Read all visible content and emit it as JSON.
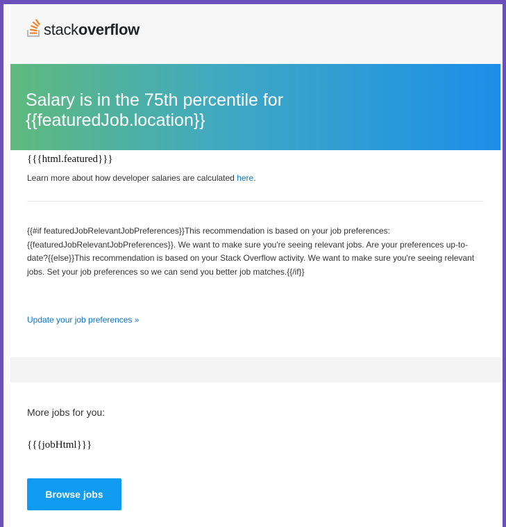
{
  "header": {
    "logo_text_light": "stack",
    "logo_text_bold": "overflow",
    "logo_icon": "stackoverflow-icon",
    "brand_color": "#f48024"
  },
  "hero": {
    "title_line1": "Salary is in the 75th percentile for",
    "title_line2": "{{featuredJob.location}}",
    "gradient_start": "#5fba7d",
    "gradient_end": "#1c8ee8"
  },
  "featured": {
    "html_template": "{{{html.featured}}}",
    "learn_more_text": "Learn more about how developer salaries are calculated ",
    "learn_more_link": "here",
    "learn_more_suffix": "."
  },
  "preferences": {
    "text": "{{#if featuredJobRelevantJobPreferences}}This recommendation is based on your job preferences: {{featuredJobRelevantJobPreferences}}. We want to make sure you're seeing relevant jobs. Are your preferences up-to-date?{{else}}This recommendation is based on your Stack Overflow activity. We want to make sure you're seeing relevant jobs. Set your job preferences so we can send you better job matches.{{/if}}",
    "update_link": "Update your job preferences »"
  },
  "more_jobs": {
    "label": "More jobs for you:",
    "job_template": "{{{jobHtml}}}",
    "browse_button": "Browse jobs",
    "button_color": "#0e9bf0"
  }
}
